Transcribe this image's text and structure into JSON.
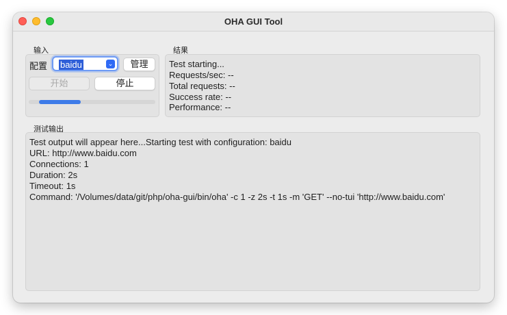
{
  "window": {
    "title": "OHA GUI Tool"
  },
  "input_section": {
    "label": "输入",
    "config_label": "配置",
    "config_value": "baidu",
    "manage_button": "管理",
    "start_button": "开始",
    "stop_button": "停止",
    "progress": 0.33
  },
  "results_section": {
    "label": "结果",
    "lines": [
      "Test starting...",
      "Requests/sec: --",
      "Total requests: --",
      "Success rate: --",
      "Performance: --"
    ]
  },
  "output_section": {
    "label": "测试输出",
    "lines": [
      "Test output will appear here...Starting test with configuration: baidu",
      "URL: http://www.baidu.com",
      "Connections: 1",
      "Duration: 2s",
      "Timeout: 1s",
      "Command: '/Volumes/data/git/php/oha-gui/bin/oha' -c 1 -z 2s -t 1s -m 'GET' --no-tui 'http://www.baidu.com'"
    ]
  },
  "colors": {
    "accent": "#3d7be8",
    "selection": "#2f5fd8",
    "close": "#ff5f57",
    "minimize": "#febc2e",
    "maximize": "#28c840"
  },
  "icons": {
    "select_arrow": "chevron-down-icon"
  }
}
